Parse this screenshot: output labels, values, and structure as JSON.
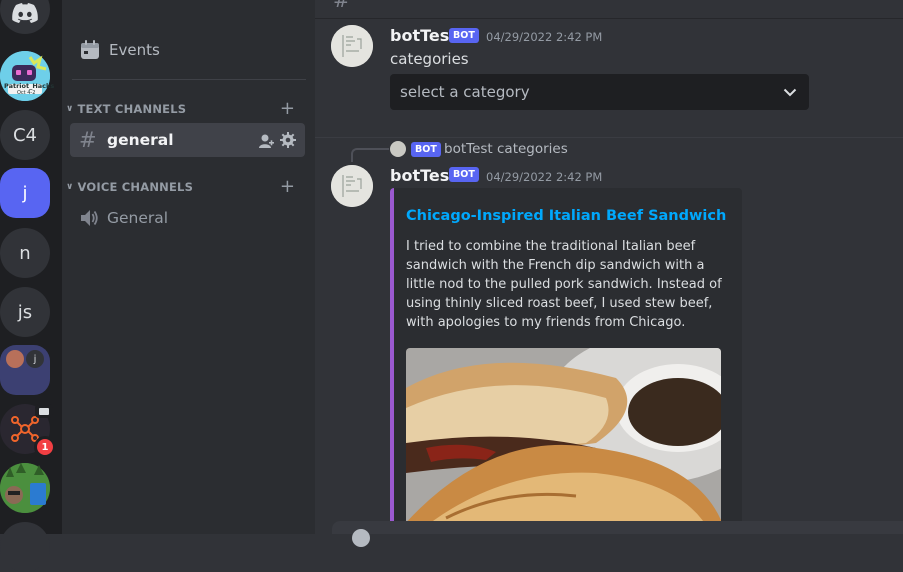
{
  "rail": {
    "servers": [
      {
        "type": "discord-logo"
      },
      {
        "type": "image",
        "caption": "Patriot Hacks"
      },
      {
        "type": "text",
        "label": "C4"
      },
      {
        "type": "text",
        "label": "j",
        "selected": true
      },
      {
        "type": "text",
        "label": "n"
      },
      {
        "type": "text",
        "label": "js"
      },
      {
        "type": "folder"
      },
      {
        "type": "image",
        "badge": "1"
      },
      {
        "type": "image"
      }
    ],
    "patriot_caption_1": "Patriot_Hacks",
    "patriot_caption_2": "Oct 4-2",
    "folder_letter": "j",
    "mention_badge": "1"
  },
  "sidebar": {
    "events_label": "Events",
    "text_category": "TEXT CHANNELS",
    "voice_category": "VOICE CHANNELS",
    "text_channel": "general",
    "voice_channel": "General"
  },
  "messages": [
    {
      "author": "botTest",
      "bot_badge": "BOT",
      "timestamp": "04/29/2022 2:42 PM",
      "content": "categories",
      "select_placeholder": "select a category"
    },
    {
      "reply_author": "botTest",
      "reply_badge": "BOT",
      "reply_text": "categories",
      "author": "botTest",
      "bot_badge": "BOT",
      "timestamp": "04/29/2022 2:42 PM",
      "embed": {
        "title": "Chicago-Inspired Italian Beef Sandwich",
        "description": "I tried to combine the traditional Italian beef sandwich with the French dip sandwich with a little nod to the pulled pork sandwich. Instead of using thinly sliced roast beef, I used stew beef, with apologies to my friends from Chicago."
      }
    }
  ],
  "colors": {
    "accent": "#5865f2",
    "embed_border": "#9b59d0",
    "link": "#00a8fc",
    "mention": "#f23f43"
  }
}
